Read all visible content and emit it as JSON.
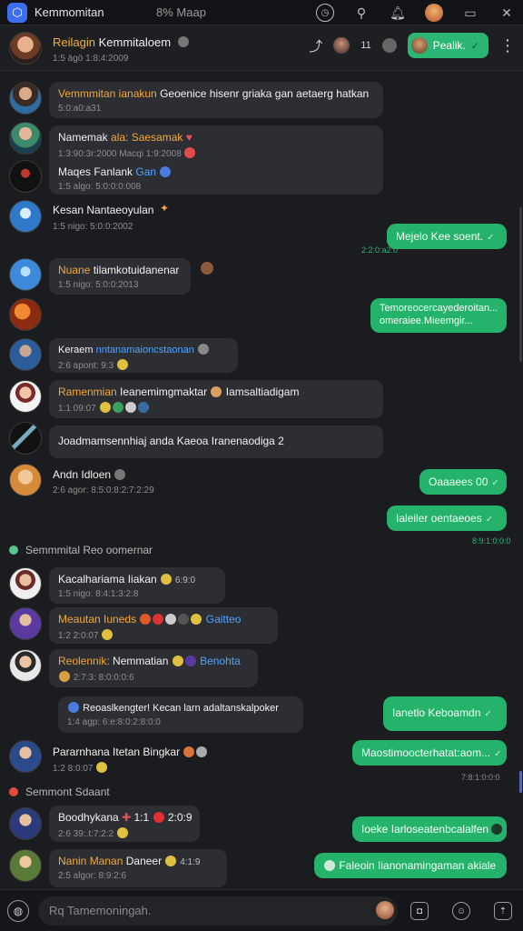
{
  "app": {
    "title": "Kemmomitan",
    "subtitle": "8% Maap"
  },
  "titlebar_icons": [
    "history-icon",
    "pin-icon",
    "bell-icon",
    "profile-icon",
    "window-icon",
    "close-icon"
  ],
  "chat_header": {
    "name_accent": "Reilagin",
    "name_rest": " Kemmitaloem",
    "time": "1:5 ägö 1:8:4:2009",
    "badge_count": "11",
    "pill_label": "Pealik.",
    "pill_color": "#2bb673"
  },
  "messages": [
    {
      "id": "m1",
      "dir": "in",
      "avatar": "a1",
      "name": "Vemmmitan ianakun",
      "text": " Geoenice hisenr griaka gan aetaerg hatkan",
      "meta": "5:0:a0:a31"
    },
    {
      "id": "m2",
      "dir": "in",
      "avatar": "a2",
      "name": "Namemak",
      "text": " ala: Saesamak",
      "meta": "1:3:90:3r:2000 Macqi 1:9:2008"
    },
    {
      "id": "m3",
      "dir": "in",
      "avatar": "a3",
      "name": "Maqes Fanlank",
      "text": " Gan",
      "meta": "1:5 algo: 5:0:0:0:008"
    },
    {
      "id": "m4",
      "dir": "in",
      "avatar": "a4",
      "name": "",
      "text": "Kesan Nantaeoyulan",
      "meta": "1:5 nigo: 5:0:0:2002"
    },
    {
      "id": "m5",
      "dir": "out",
      "text": "Mejelo Kee soent.",
      "time": "2:2:0:a2:0"
    },
    {
      "id": "m6",
      "dir": "in",
      "avatar": "a5",
      "name": "Nuane",
      "text": " tilamkotuidanenar",
      "meta": "1:5 nigo: 5:0:0:2013"
    },
    {
      "id": "m7",
      "dir": "out",
      "line1": "Temoreocercayederoitan...",
      "line2": "omeraiee.Mieemgir..."
    },
    {
      "id": "m8",
      "dir": "in",
      "avatar": "a6",
      "name": "Keraem",
      "text": " nntanamaioncstaonan",
      "meta": "2:6 apont: 9:3"
    },
    {
      "id": "m9",
      "dir": "in",
      "avatar": "a7",
      "name": "Ramenmian",
      "text": " Ieanemimgmaktar",
      "meta": "1:1 09:07",
      "trail": " Iamsaltiadigam"
    },
    {
      "id": "m10",
      "dir": "in",
      "avatar": "a8",
      "text": "Joadmamsennhiaj anda Kaeoa Iranenaodiga 2"
    },
    {
      "id": "m11",
      "dir": "in",
      "avatar": "a9",
      "name": "Andn Idloen",
      "meta": "2:6 agor: 8:5:0:8:2:7:2:29"
    },
    {
      "id": "m12",
      "dir": "out",
      "text": "Oaaaees 00"
    },
    {
      "id": "m13",
      "dir": "out",
      "text": "Ialeiler oentaeoes",
      "time": "8:9:1:0:0:0"
    },
    {
      "id": "m14",
      "dir": "in",
      "avatar": "a10",
      "name": "Kacalhariama Iiakan",
      "meta": "1:5 nigo: 8:4:1:3:2:8",
      "trail": " 6:9:0"
    },
    {
      "id": "m15",
      "dir": "in",
      "avatar": "a11",
      "name": "Meautan Iuneds",
      "meta": "1:2 2:0:07",
      "trail": " Gaitteo"
    },
    {
      "id": "m16",
      "dir": "in",
      "avatar": "a12",
      "name": "Reolennik:",
      "text": " Nemmatian",
      "meta": "2:7:3: 8:0:0:0:6",
      "trail": " Benohta"
    },
    {
      "id": "m17",
      "dir": "in",
      "text": "Reoaslkengter! Kecan larn adaltanskalpoker",
      "meta": "1:4 agp: 6:e:8:0:2:8:0:0"
    },
    {
      "id": "m18",
      "dir": "out",
      "text": "Ianetlo Keboamdn"
    },
    {
      "id": "m19",
      "dir": "in",
      "avatar": "a13",
      "name": "Pararnhana Itetan Bingkar",
      "meta": "1:2 8:0:07"
    },
    {
      "id": "m20",
      "dir": "out",
      "text": "Maostimoocterhatat:aom...",
      "time": "7:8:1:0:0:0"
    },
    {
      "id": "m21",
      "dir": "in",
      "avatar": "a14",
      "name": "Boodhykana",
      "text": " 1:1",
      "meta": "2:6 39:.t:7:2:2",
      "trail": " 2:0:9"
    },
    {
      "id": "m22",
      "dir": "out",
      "text": "Ioeke Iarloseatenbcalalfen"
    },
    {
      "id": "m23",
      "dir": "in",
      "avatar": "a15",
      "name": "Nanin Manan",
      "text": " Daneer",
      "meta": "2:5 algor: 8:9:2:6",
      "trail": " 4:1:9"
    },
    {
      "id": "m24",
      "dir": "out",
      "text": "Faleoin Iianonamingaman akiale"
    }
  ],
  "separators": [
    {
      "label": "Semmmital Reo oomernar",
      "color": "#58c48b"
    },
    {
      "label": "Semmont Sdaant",
      "color": "#e24a3a"
    }
  ],
  "composer": {
    "placeholder": "Rq Tamemoningah."
  }
}
